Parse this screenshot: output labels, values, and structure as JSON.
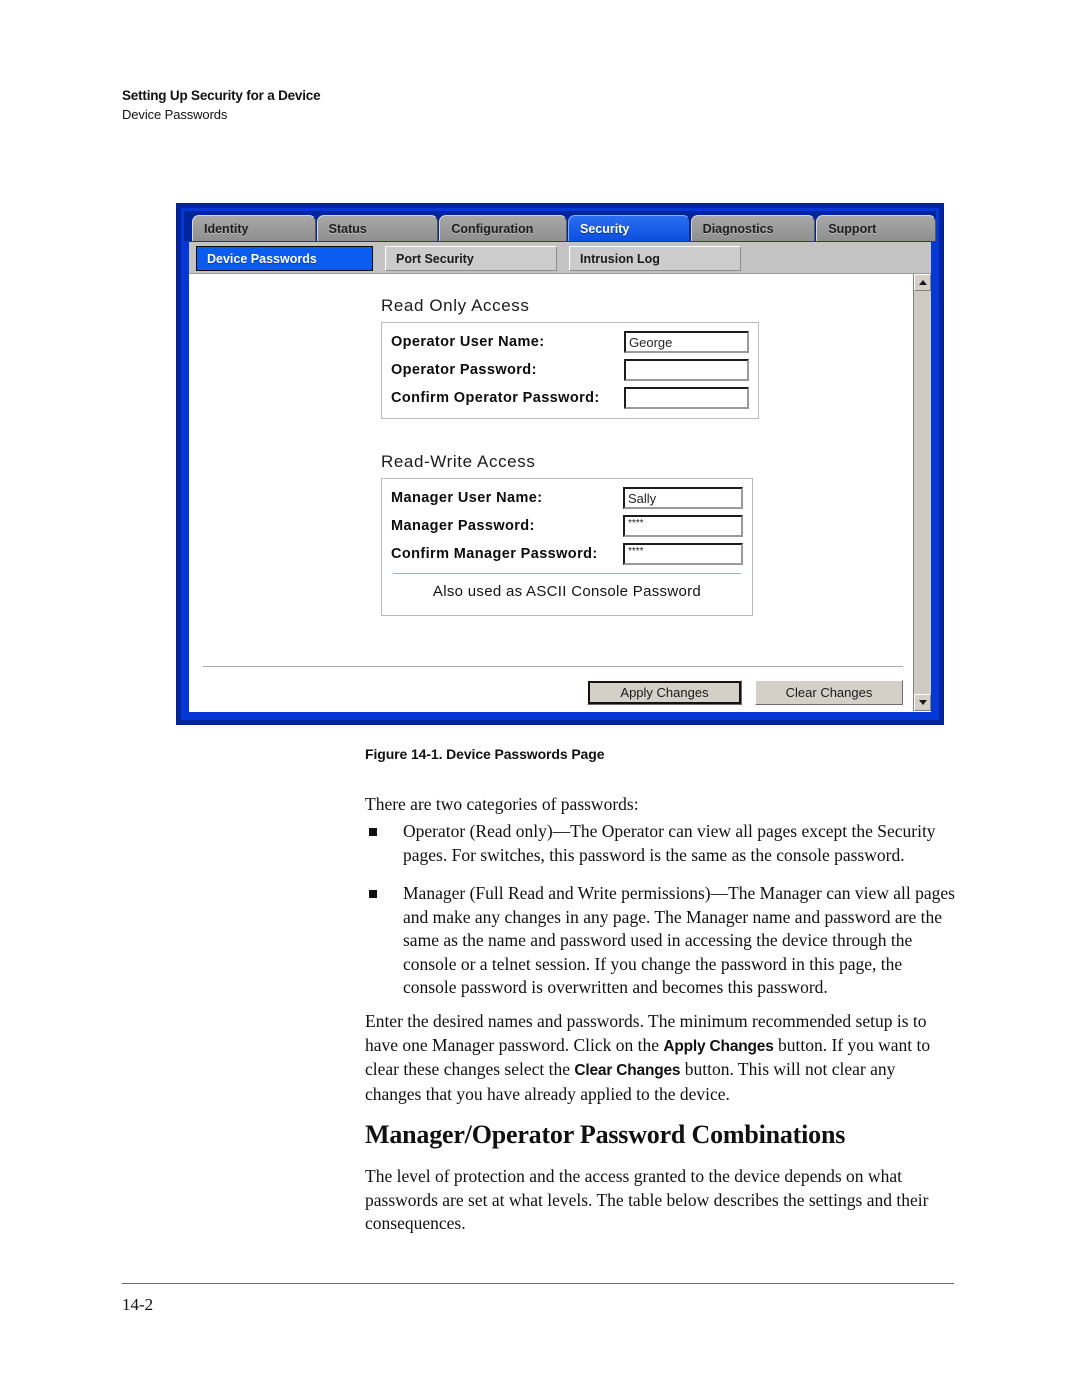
{
  "header": {
    "running_head": "Setting Up Security for a Device",
    "sub_head": "Device Passwords"
  },
  "screenshot": {
    "main_tabs": [
      {
        "label": "Identity",
        "active": false
      },
      {
        "label": "Status",
        "active": false
      },
      {
        "label": "Configuration",
        "active": false
      },
      {
        "label": "Security",
        "active": true
      },
      {
        "label": "Diagnostics",
        "active": false
      },
      {
        "label": "Support",
        "active": false
      }
    ],
    "sub_tabs": [
      {
        "label": "Device Passwords",
        "active": true
      },
      {
        "label": "Port Security",
        "active": false
      },
      {
        "label": "Intrusion Log",
        "active": false
      }
    ],
    "read_only": {
      "title": "Read Only Access",
      "fields": [
        {
          "label": "Operator User Name:",
          "value": "George",
          "masked": false
        },
        {
          "label": "Operator Password:",
          "value": "",
          "masked": true
        },
        {
          "label": "Confirm Operator Password:",
          "value": "",
          "masked": true
        }
      ]
    },
    "read_write": {
      "title": "Read-Write Access",
      "fields": [
        {
          "label": "Manager User Name:",
          "value": "Sally",
          "masked": false
        },
        {
          "label": "Manager Password:",
          "value": "****",
          "masked": true
        },
        {
          "label": "Confirm Manager Password:",
          "value": "****",
          "masked": true
        }
      ],
      "note": "Also used as ASCII Console Password"
    },
    "buttons": {
      "apply": "Apply Changes",
      "clear": "Clear Changes"
    },
    "scrollbar": {
      "up_icon": "triangle-up-icon",
      "down_icon": "triangle-down-icon"
    },
    "colors": {
      "frame_blue": "#0536d6",
      "frame_dark_blue": "#00249c",
      "active_tab_blue": "#0c4fe0",
      "tab_gray": "#9a9a9a",
      "subtab_bar": "#c3c3c3",
      "button_face": "#d4d0c8"
    }
  },
  "figure": {
    "caption": "Figure 14-1. Device Passwords Page"
  },
  "body": {
    "intro": "There are two categories of passwords:",
    "bullets": [
      "Operator (Read only)—The Operator can view all pages except the Security pages. For switches, this password is the same as the console password.",
      "Manager (Full Read and Write permissions)—The Manager can view all pages and make any changes in any page. The Manager name and password are the same as the name and password used in accessing the device through the console or a telnet session. If you change the password in this page, the console password is overwritten and becomes this password."
    ],
    "enter_para": {
      "part1": "Enter the desired names and passwords. The minimum recommended setup is to have one Manager password. Click on the ",
      "bold1": "Apply Changes",
      "part2": " button. If you want to clear these changes select the ",
      "bold2": "Clear Changes",
      "part3": " button. This will not clear any changes that you have already applied to the device."
    },
    "heading2": "Manager/Operator Password Combinations",
    "level_para": "The level of protection and the access granted to the device depends on what passwords are set at what levels. The table below describes the settings and their consequences."
  },
  "footer": {
    "page_number": "14-2"
  }
}
